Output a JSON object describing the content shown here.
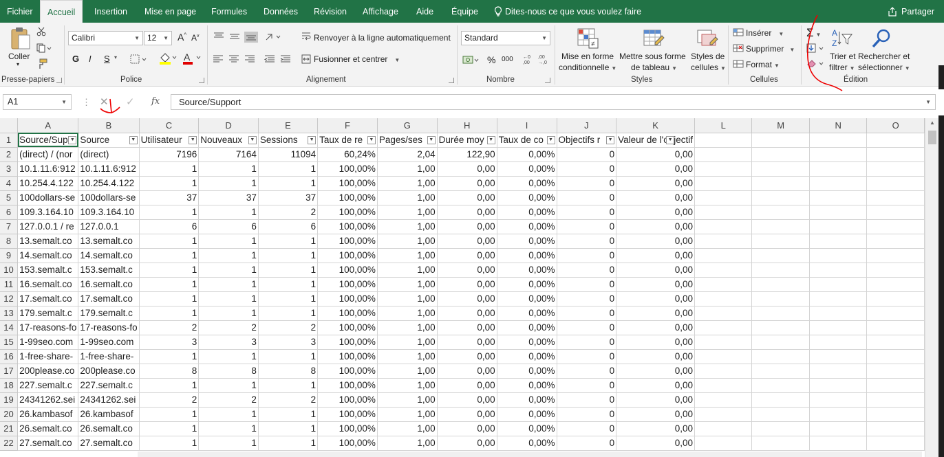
{
  "tabs": [
    "Fichier",
    "Accueil",
    "Insertion",
    "Mise en page",
    "Formules",
    "Données",
    "Révision",
    "Affichage",
    "Aide",
    "Équipe"
  ],
  "active_tab": "Accueil",
  "tell_me": "Dites-nous ce que vous voulez faire",
  "share": "Partager",
  "ribbon": {
    "clipboard": {
      "paste": "Coller",
      "group": "Presse-papiers"
    },
    "font": {
      "name": "Calibri",
      "size": "12",
      "bold": "G",
      "italic": "I",
      "underline": "S",
      "group": "Police"
    },
    "alignment": {
      "wrap": "Renvoyer à la ligne automatiquement",
      "merge": "Fusionner et centrer",
      "group": "Alignement"
    },
    "number": {
      "format": "Standard",
      "percent": "%",
      "thousands": "000",
      "group": "Nombre"
    },
    "styles": {
      "conditional_1": "Mise en forme",
      "conditional_2": "conditionnelle",
      "table_1": "Mettre sous forme",
      "table_2": "de tableau",
      "cell_1": "Styles de",
      "cell_2": "cellules",
      "group": "Styles"
    },
    "cells": {
      "insert": "Insérer",
      "delete": "Supprimer",
      "format": "Format",
      "group": "Cellules"
    },
    "editing": {
      "sort_1": "Trier et",
      "sort_2": "filtrer",
      "find_1": "Rechercher et",
      "find_2": "sélectionner",
      "group": "Édition"
    }
  },
  "formula_bar": {
    "name_box": "A1",
    "fx": "fx",
    "content": "Source/Support"
  },
  "columns": [
    "A",
    "B",
    "C",
    "D",
    "E",
    "F",
    "G",
    "H",
    "I",
    "J",
    "K",
    "L",
    "M",
    "N",
    "O"
  ],
  "headers": [
    "Source/Sup",
    "Source",
    "Utilisateur",
    "Nouveaux",
    "Sessions",
    "Taux de re",
    "Pages/ses",
    "Durée moy",
    "Taux de co",
    "Objectifs r",
    "Valeur de l'objectif"
  ],
  "rows": [
    [
      "(direct) / (nor",
      "(direct)",
      "7196",
      "7164",
      "11094",
      "60,24%",
      "2,04",
      "122,90",
      "0,00%",
      "0",
      "0,00"
    ],
    [
      "10.1.11.6:912",
      "10.1.11.6:912",
      "1",
      "1",
      "1",
      "100,00%",
      "1,00",
      "0,00",
      "0,00%",
      "0",
      "0,00"
    ],
    [
      "10.254.4.122",
      "10.254.4.122",
      "1",
      "1",
      "1",
      "100,00%",
      "1,00",
      "0,00",
      "0,00%",
      "0",
      "0,00"
    ],
    [
      "100dollars-se",
      "100dollars-se",
      "37",
      "37",
      "37",
      "100,00%",
      "1,00",
      "0,00",
      "0,00%",
      "0",
      "0,00"
    ],
    [
      "109.3.164.10",
      "109.3.164.10",
      "1",
      "1",
      "2",
      "100,00%",
      "1,00",
      "0,00",
      "0,00%",
      "0",
      "0,00"
    ],
    [
      "127.0.0.1 / re",
      "127.0.0.1",
      "6",
      "6",
      "6",
      "100,00%",
      "1,00",
      "0,00",
      "0,00%",
      "0",
      "0,00"
    ],
    [
      "13.semalt.co",
      "13.semalt.co",
      "1",
      "1",
      "1",
      "100,00%",
      "1,00",
      "0,00",
      "0,00%",
      "0",
      "0,00"
    ],
    [
      "14.semalt.co",
      "14.semalt.co",
      "1",
      "1",
      "1",
      "100,00%",
      "1,00",
      "0,00",
      "0,00%",
      "0",
      "0,00"
    ],
    [
      "153.semalt.c",
      "153.semalt.c",
      "1",
      "1",
      "1",
      "100,00%",
      "1,00",
      "0,00",
      "0,00%",
      "0",
      "0,00"
    ],
    [
      "16.semalt.co",
      "16.semalt.co",
      "1",
      "1",
      "1",
      "100,00%",
      "1,00",
      "0,00",
      "0,00%",
      "0",
      "0,00"
    ],
    [
      "17.semalt.co",
      "17.semalt.co",
      "1",
      "1",
      "1",
      "100,00%",
      "1,00",
      "0,00",
      "0,00%",
      "0",
      "0,00"
    ],
    [
      "179.semalt.c",
      "179.semalt.c",
      "1",
      "1",
      "1",
      "100,00%",
      "1,00",
      "0,00",
      "0,00%",
      "0",
      "0,00"
    ],
    [
      "17-reasons-fo",
      "17-reasons-fo",
      "2",
      "2",
      "2",
      "100,00%",
      "1,00",
      "0,00",
      "0,00%",
      "0",
      "0,00"
    ],
    [
      "1-99seo.com",
      "1-99seo.com",
      "3",
      "3",
      "3",
      "100,00%",
      "1,00",
      "0,00",
      "0,00%",
      "0",
      "0,00"
    ],
    [
      "1-free-share-",
      "1-free-share-",
      "1",
      "1",
      "1",
      "100,00%",
      "1,00",
      "0,00",
      "0,00%",
      "0",
      "0,00"
    ],
    [
      "200please.co",
      "200please.co",
      "8",
      "8",
      "8",
      "100,00%",
      "1,00",
      "0,00",
      "0,00%",
      "0",
      "0,00"
    ],
    [
      "227.semalt.c",
      "227.semalt.c",
      "1",
      "1",
      "1",
      "100,00%",
      "1,00",
      "0,00",
      "0,00%",
      "0",
      "0,00"
    ],
    [
      "24341262.sei",
      "24341262.sei",
      "2",
      "2",
      "2",
      "100,00%",
      "1,00",
      "0,00",
      "0,00%",
      "0",
      "0,00"
    ],
    [
      "26.kambasof",
      "26.kambasof",
      "1",
      "1",
      "1",
      "100,00%",
      "1,00",
      "0,00",
      "0,00%",
      "0",
      "0,00"
    ],
    [
      "26.semalt.co",
      "26.semalt.co",
      "1",
      "1",
      "1",
      "100,00%",
      "1,00",
      "0,00",
      "0,00%",
      "0",
      "0,00"
    ],
    [
      "27.semalt.co",
      "27.semalt.co",
      "1",
      "1",
      "1",
      "100,00%",
      "1,00",
      "0,00",
      "0,00%",
      "0",
      "0,00"
    ]
  ]
}
